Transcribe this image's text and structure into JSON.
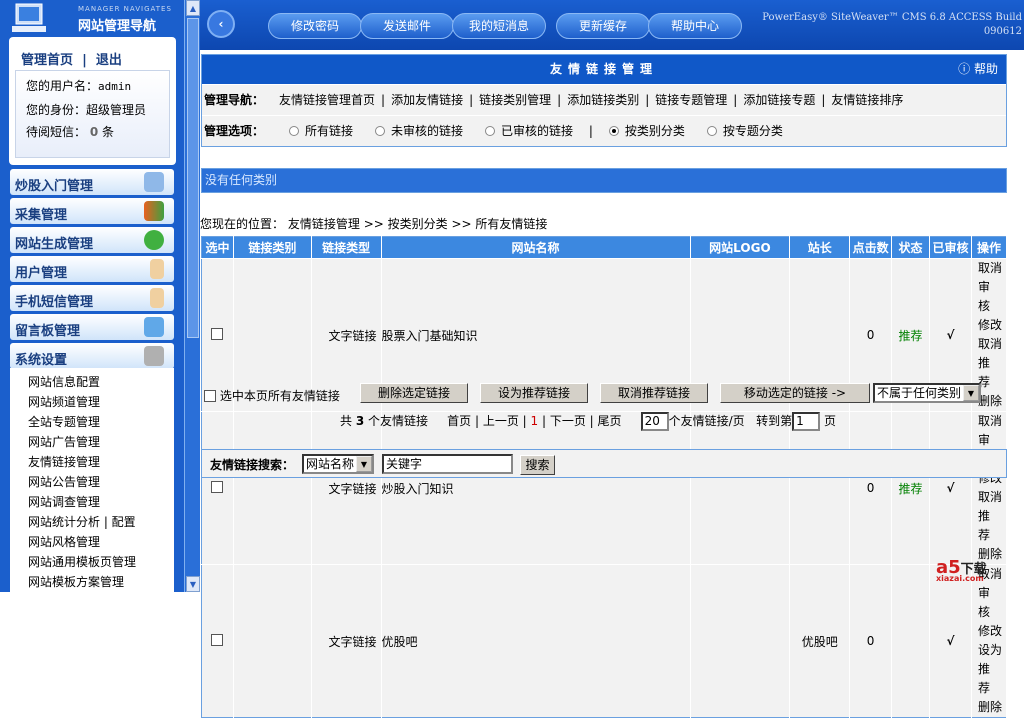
{
  "sidebar": {
    "logo_en": "MANAGER NAVIGATES",
    "logo_cn": "网站管理导航",
    "home": "管理首页",
    "sep": "|",
    "logout": "退出",
    "username_label": "您的用户名：",
    "username": "admin",
    "role_label": "您的身份：",
    "role": "超级管理员",
    "msg_label": "待阅短信：",
    "msg_count": "0",
    "msg_unit": "条",
    "menus": [
      "炒股入门管理",
      "采集管理",
      "网站生成管理",
      "用户管理",
      "手机短信管理",
      "留言板管理",
      "系统设置"
    ],
    "subitems": [
      "网站信息配置",
      "网站频道管理",
      "全站专题管理",
      "网站广告管理",
      "友情链接管理",
      "网站公告管理",
      "网站调查管理",
      "网站统计分析 | 配置",
      "网站风格管理",
      "网站通用模板页管理",
      "网站模板方案管理"
    ]
  },
  "topbar": {
    "buttons": [
      "修改密码",
      "发送邮件",
      "我的短消息",
      "更新缓存",
      "帮助中心"
    ],
    "version_line1": "PowerEasy® SiteWeaver™ CMS 6.8 ACCESS Build",
    "version_line2": "090612"
  },
  "panel": {
    "title": "友情链接管理",
    "help": "帮助",
    "nav_label": "管理导航：",
    "nav": [
      "友情链接管理首页",
      "添加友情链接",
      "链接类别管理",
      "添加链接类别",
      "链接专题管理",
      "添加链接专题",
      "友情链接排序"
    ],
    "opt_label": "管理选项：",
    "options": [
      "所有链接",
      "未审核的链接",
      "已审核的链接",
      "按类别分类",
      "按专题分类"
    ],
    "selected_option": "按类别分类"
  },
  "no_category": "没有任何类别",
  "breadcrumb": {
    "label": "您现在的位置：",
    "items": [
      "友情链接管理",
      ">>",
      "按类别分类",
      ">>",
      "所有友情链接"
    ]
  },
  "table": {
    "headers": [
      "选中",
      "链接类别",
      "链接类型",
      "网站名称",
      "网站LOGO",
      "站长",
      "点击数",
      "状态",
      "已审核",
      "操作"
    ],
    "rows": [
      {
        "category": "",
        "type": "文字链接",
        "name": "股票入门基础知识",
        "logo": "",
        "owner": "",
        "hits": "0",
        "status": "推荐",
        "audited": "√",
        "ops": [
          "取消审核",
          "修改",
          "取消推荐",
          "删除"
        ]
      },
      {
        "category": "",
        "type": "文字链接",
        "name": "炒股入门知识",
        "logo": "",
        "owner": "",
        "hits": "0",
        "status": "推荐",
        "audited": "√",
        "ops": [
          "取消审核",
          "修改",
          "取消推荐",
          "删除"
        ]
      },
      {
        "category": "",
        "type": "文字链接",
        "name": "优股吧",
        "logo": "",
        "owner": "优股吧",
        "hits": "0",
        "status": "",
        "audited": "√",
        "ops": [
          "取消审核",
          "修改",
          "设为推荐",
          "删除"
        ]
      }
    ]
  },
  "actions": {
    "select_all": "选中本页所有友情链接",
    "delete": "删除选定链接",
    "recommend": "设为推荐链接",
    "unrecommend": "取消推荐链接",
    "move": "移动选定的链接 ->",
    "move_target": "不属于任何类别"
  },
  "pager": {
    "total_pre": "共",
    "total": "3",
    "total_post": "个友情链接",
    "first": "首页",
    "prev": "上一页",
    "current": "1",
    "next": "下一页",
    "last": "尾页",
    "per_page": "20",
    "per_page_label": "个友情链接/页",
    "goto_label": "转到第",
    "goto_value": "1",
    "goto_unit": "页"
  },
  "search": {
    "label": "友情链接搜索：",
    "field": "网站名称",
    "keyword": "关键字",
    "button": "搜索"
  },
  "watermark": {
    "text": "a5下载",
    "sub": "xiazai.com"
  },
  "colors": {
    "accent": "#1058c8",
    "recommend": "#008000"
  }
}
